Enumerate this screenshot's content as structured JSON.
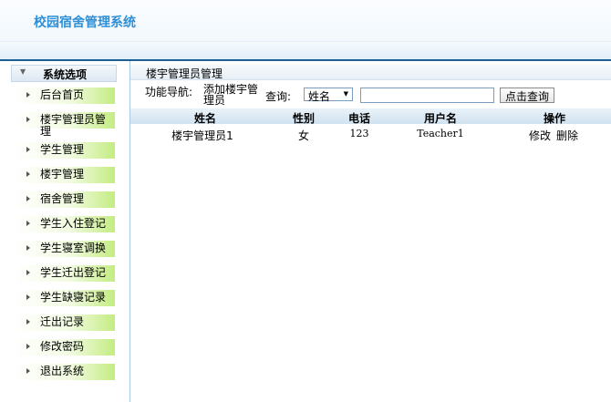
{
  "app": {
    "title": "校园宿舍管理系统"
  },
  "sidebar": {
    "header": "系统选项",
    "items": [
      {
        "label": "后台首页"
      },
      {
        "label": "楼宇管理员管理"
      },
      {
        "label": "学生管理"
      },
      {
        "label": "楼宇管理"
      },
      {
        "label": "宿舍管理"
      },
      {
        "label": "学生入住登记"
      },
      {
        "label": "学生寝室调换"
      },
      {
        "label": "学生迁出登记"
      },
      {
        "label": "学生缺寝记录"
      },
      {
        "label": "迁出记录"
      },
      {
        "label": "修改密码"
      },
      {
        "label": "退出系统"
      }
    ]
  },
  "main": {
    "title": "楼宇管理员管理",
    "nav_label": "功能导航:",
    "nav_link": "添加楼宇管理员",
    "query_label": "查询:",
    "select_value": "姓名",
    "search_value": "",
    "search_button": "点击查询",
    "table": {
      "headers": [
        "姓名",
        "性别",
        "电话",
        "用户名",
        "操作"
      ],
      "rows": [
        {
          "name": "楼宇管理员1",
          "gender": "女",
          "phone": "123",
          "username": "Teacher1",
          "edit": "修改",
          "delete": "删除"
        }
      ]
    }
  }
}
